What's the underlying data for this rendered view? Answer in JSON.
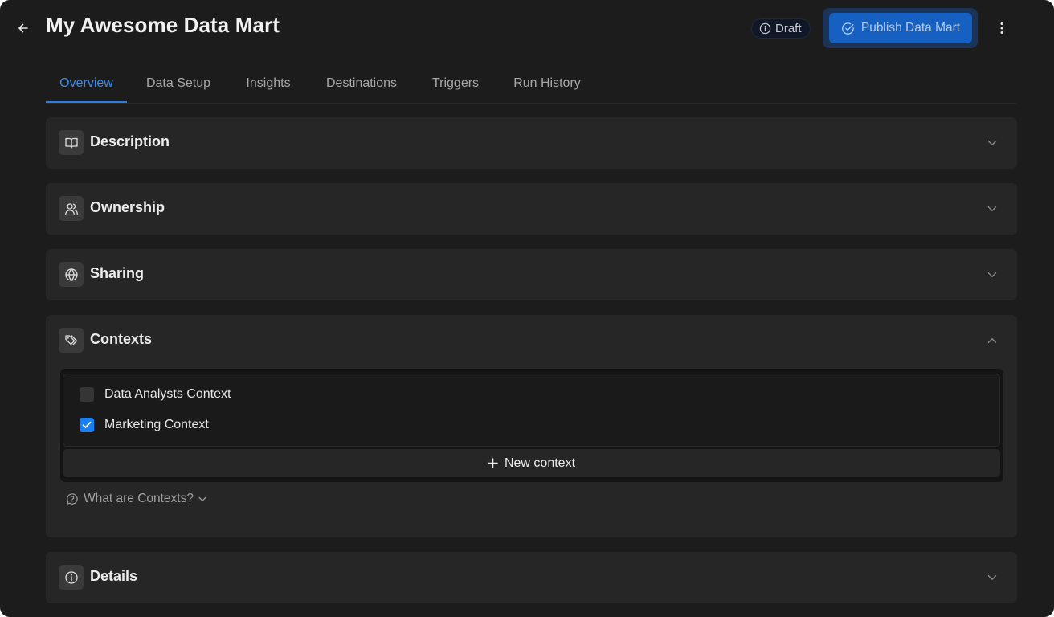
{
  "header": {
    "back_icon": "arrow-left-icon",
    "title": "My Awesome Data Mart",
    "status_badge": "Draft",
    "publish_label": "Publish Data Mart",
    "more_icon": "more-vertical-icon"
  },
  "tabs": [
    {
      "label": "Overview",
      "active": true
    },
    {
      "label": "Data Setup",
      "active": false
    },
    {
      "label": "Insights",
      "active": false
    },
    {
      "label": "Destinations",
      "active": false
    },
    {
      "label": "Triggers",
      "active": false
    },
    {
      "label": "Run History",
      "active": false
    }
  ],
  "sections": {
    "description": {
      "title": "Description",
      "icon": "book-open-icon",
      "expanded": false
    },
    "ownership": {
      "title": "Ownership",
      "icon": "users-icon",
      "expanded": false
    },
    "sharing": {
      "title": "Sharing",
      "icon": "globe-icon",
      "expanded": false
    },
    "contexts": {
      "title": "Contexts",
      "icon": "tags-icon",
      "expanded": true,
      "items": [
        {
          "label": "Data Analysts Context",
          "checked": false
        },
        {
          "label": "Marketing Context",
          "checked": true
        }
      ],
      "new_context_label": "New context",
      "help_label": "What are Contexts?"
    },
    "details": {
      "title": "Details",
      "icon": "info-icon",
      "expanded": false
    }
  },
  "colors": {
    "background": "#1c1c1c",
    "card": "#262626",
    "accent": "#3b8bf0",
    "publish_button": "#1560c0",
    "checkbox_checked": "#1a7ff0"
  }
}
